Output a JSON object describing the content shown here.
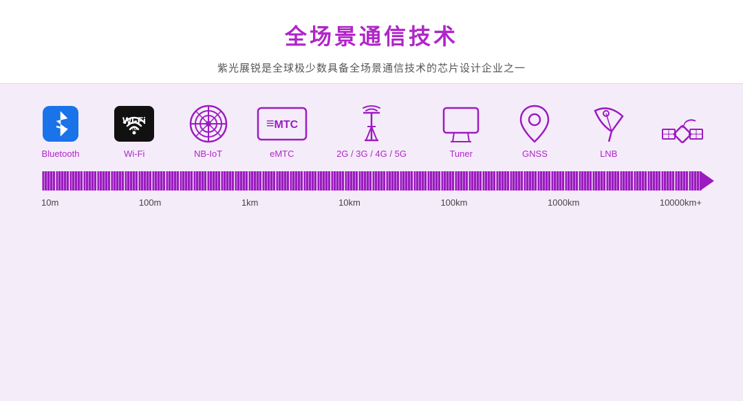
{
  "header": {
    "title": "全场景通信技术",
    "subtitle": "紫光展锐是全球极少数具备全场景通信技术的芯片设计企业之一"
  },
  "technologies": [
    {
      "id": "bluetooth",
      "label": "Bluetooth",
      "icon_type": "bluetooth"
    },
    {
      "id": "wifi",
      "label": "Wi-Fi",
      "icon_type": "wifi"
    },
    {
      "id": "nbiot",
      "label": "NB-IoT",
      "icon_type": "nbiot"
    },
    {
      "id": "emtc",
      "label": "eMTC",
      "icon_type": "emtc"
    },
    {
      "id": "cellular",
      "label": "2G / 3G / 4G / 5G",
      "icon_type": "cellular"
    },
    {
      "id": "tuner",
      "label": "Tuner",
      "icon_type": "tuner"
    },
    {
      "id": "gnss",
      "label": "GNSS",
      "icon_type": "gnss"
    },
    {
      "id": "lnb",
      "label": "LNB",
      "icon_type": "lnb"
    },
    {
      "id": "satellite",
      "label": "",
      "icon_type": "satellite"
    }
  ],
  "distances": [
    "10m",
    "100m",
    "1km",
    "10km",
    "100km",
    "1000km",
    "10000km+"
  ]
}
